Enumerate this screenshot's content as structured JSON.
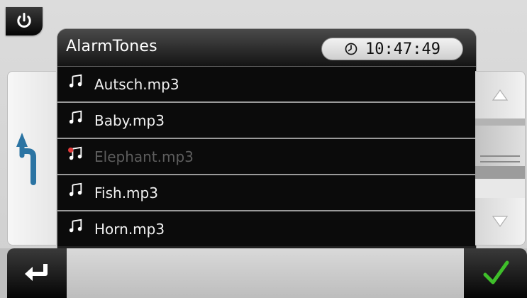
{
  "header": {
    "title": "AlarmTones",
    "clock_time": "10:47:49"
  },
  "tones": [
    {
      "name": "Autsch.mp3",
      "selected": false
    },
    {
      "name": "Baby.mp3",
      "selected": false
    },
    {
      "name": "Elephant.mp3",
      "selected": true
    },
    {
      "name": "Fish.mp3",
      "selected": false
    },
    {
      "name": "Horn.mp3",
      "selected": false
    }
  ],
  "colors": {
    "list_background": "#0b0b0b",
    "selected_marker": "#e23b3b",
    "confirm_check": "#3fbf2a"
  },
  "icons": {
    "power": "power-icon",
    "back_up": "back-up-arrow-icon",
    "clock": "clock-icon",
    "note": "music-note-icon",
    "scroll_up": "triangle-up-icon",
    "scroll_down": "triangle-down-icon",
    "enter": "enter-arrow-icon",
    "confirm": "checkmark-icon"
  }
}
